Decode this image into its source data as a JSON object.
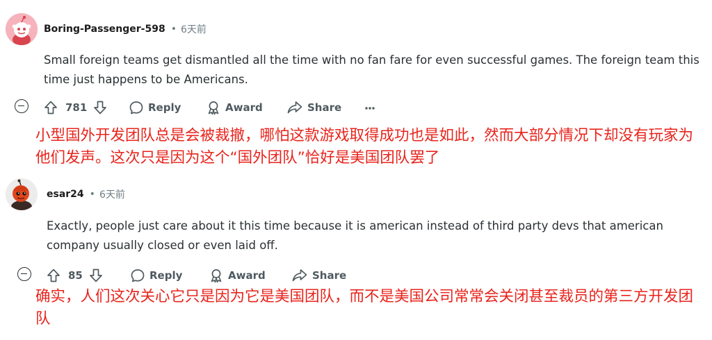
{
  "comments": [
    {
      "username": "Boring-Passenger-598",
      "time": "6天前",
      "body": "Small foreign teams get dismantled all the time with no fan fare for even successful games. The foreign team this time just happens to be Americans.",
      "votes": "781",
      "reply_label": "Reply",
      "award_label": "Award",
      "share_label": "Share",
      "translation": "小型国外开发团队总是会被裁撤，哪怕这款游戏取得成功也是如此，然而大部分情况下却没有玩家为他们发声。这次只是因为这个“国外团队”恰好是美国团队罢了"
    },
    {
      "username": "esar24",
      "time": "6天前",
      "body": "Exactly, people just care about it this time because it is american instead of third party devs that american company usually closed or even laid off.",
      "votes": "85",
      "reply_label": "Reply",
      "award_label": "Award",
      "share_label": "Share",
      "translation": "确实，人们这次关心它只是因为它是美国团队，而不是美国公司常常会关闭甚至裁员的第三方开发团队"
    }
  ],
  "separator": "•",
  "colors": {
    "translation": "#e8231b",
    "meta": "#6f7d83",
    "action": "#4f5a5f"
  },
  "icons": [
    "collapse-icon",
    "upvote-icon",
    "downvote-icon",
    "reply-icon",
    "award-icon",
    "share-icon",
    "more-icon"
  ]
}
